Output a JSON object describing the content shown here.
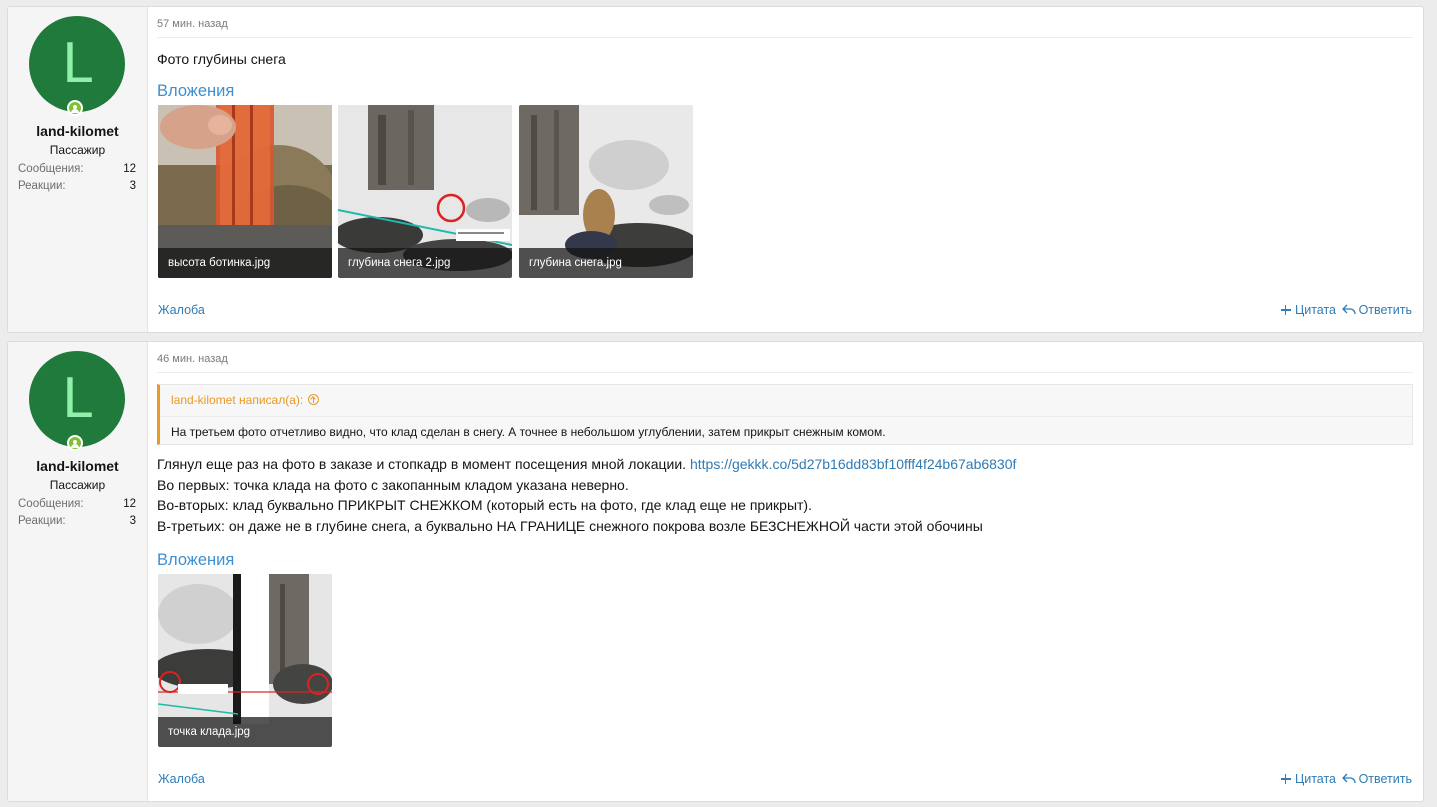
{
  "posts": [
    {
      "user": {
        "avatar_letter": "L",
        "name": "land-kilomet",
        "title": "Пассажир",
        "stats": [
          {
            "label": "Сообщения:",
            "value": "12"
          },
          {
            "label": "Реакции:",
            "value": "3"
          }
        ]
      },
      "date": "57 мин. назад",
      "text": "Фото глубины снега",
      "attachments_title": "Вложения",
      "attachments": [
        {
          "name": "высота ботинка.jpg"
        },
        {
          "name": "глубина снега 2.jpg"
        },
        {
          "name": "глубина снега.jpg"
        }
      ],
      "actions": {
        "report": "Жалоба",
        "quote": "Цитата",
        "reply": "Ответить"
      }
    },
    {
      "user": {
        "avatar_letter": "L",
        "name": "land-kilomet",
        "title": "Пассажир",
        "stats": [
          {
            "label": "Сообщения:",
            "value": "12"
          },
          {
            "label": "Реакции:",
            "value": "3"
          }
        ]
      },
      "date": "46 мин. назад",
      "quote": {
        "author_line": "land-kilomet написал(а):",
        "body": "На третьем фото отчетливо видно, что клад сделан в снегу. А точнее в небольшом углублении, затем прикрыт снежным комом."
      },
      "lines": [
        {
          "text": "Глянул еще раз на фото в заказе и стопкадр в момент посещения мной локации. ",
          "link": "https://gekkk.co/5d27b16dd83bf10fff4f24b67ab6830f"
        },
        {
          "text": "Во первых: точка клада на фото с закопанным кладом указана неверно."
        },
        {
          "text": "Во-вторых: клад буквально ПРИКРЫТ СНЕЖКОМ (который есть на фото, где клад еще не прикрыт)."
        },
        {
          "text": "В-третьих: он даже не в глубине снега, а буквально НА ГРАНИЦЕ снежного покрова возле БЕЗСНЕЖНОЙ части этой обочины"
        }
      ],
      "attachments_title": "Вложения",
      "attachments": [
        {
          "name": "точка клада.jpg"
        }
      ],
      "actions": {
        "report": "Жалоба",
        "quote": "Цитата",
        "reply": "Ответить"
      }
    }
  ],
  "colors": {
    "avatar_bg": "#1f7a3b",
    "avatar_letter": "#8ff0a8",
    "online": "#7fbf32",
    "link": "#2f7bb5",
    "attachments_heading": "#3f8fd0",
    "quote_accent": "#e89a26"
  },
  "icons": {
    "online": "user-online-icon",
    "quote": "plus-icon",
    "reply": "reply-arrow-icon",
    "quote_jump": "arrow-up-circle-icon"
  }
}
